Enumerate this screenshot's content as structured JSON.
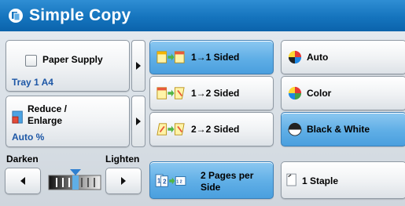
{
  "title": "Simple Copy",
  "paper_supply": {
    "label": "Paper Supply",
    "value": "Tray 1 A4"
  },
  "reduce_enlarge": {
    "label_line1": "Reduce /",
    "label_line2": "Enlarge",
    "value": "Auto %"
  },
  "density": {
    "darken_label": "Darken",
    "lighten_label": "Lighten",
    "level": 0.5
  },
  "sided": {
    "one_to_one": "1→1 Sided",
    "one_to_two": "1→2 Sided",
    "two_to_two": "2→2 Sided"
  },
  "color": {
    "auto": "Auto",
    "color": "Color",
    "bw": "Black & White"
  },
  "pages_per_side": {
    "line1": "2 Pages per",
    "line2": "Side"
  },
  "staple": {
    "label": "1 Staple"
  },
  "colors": {
    "title_bar": "#1574be",
    "selected": "#5faee6",
    "value_text": "#1d57a6"
  }
}
